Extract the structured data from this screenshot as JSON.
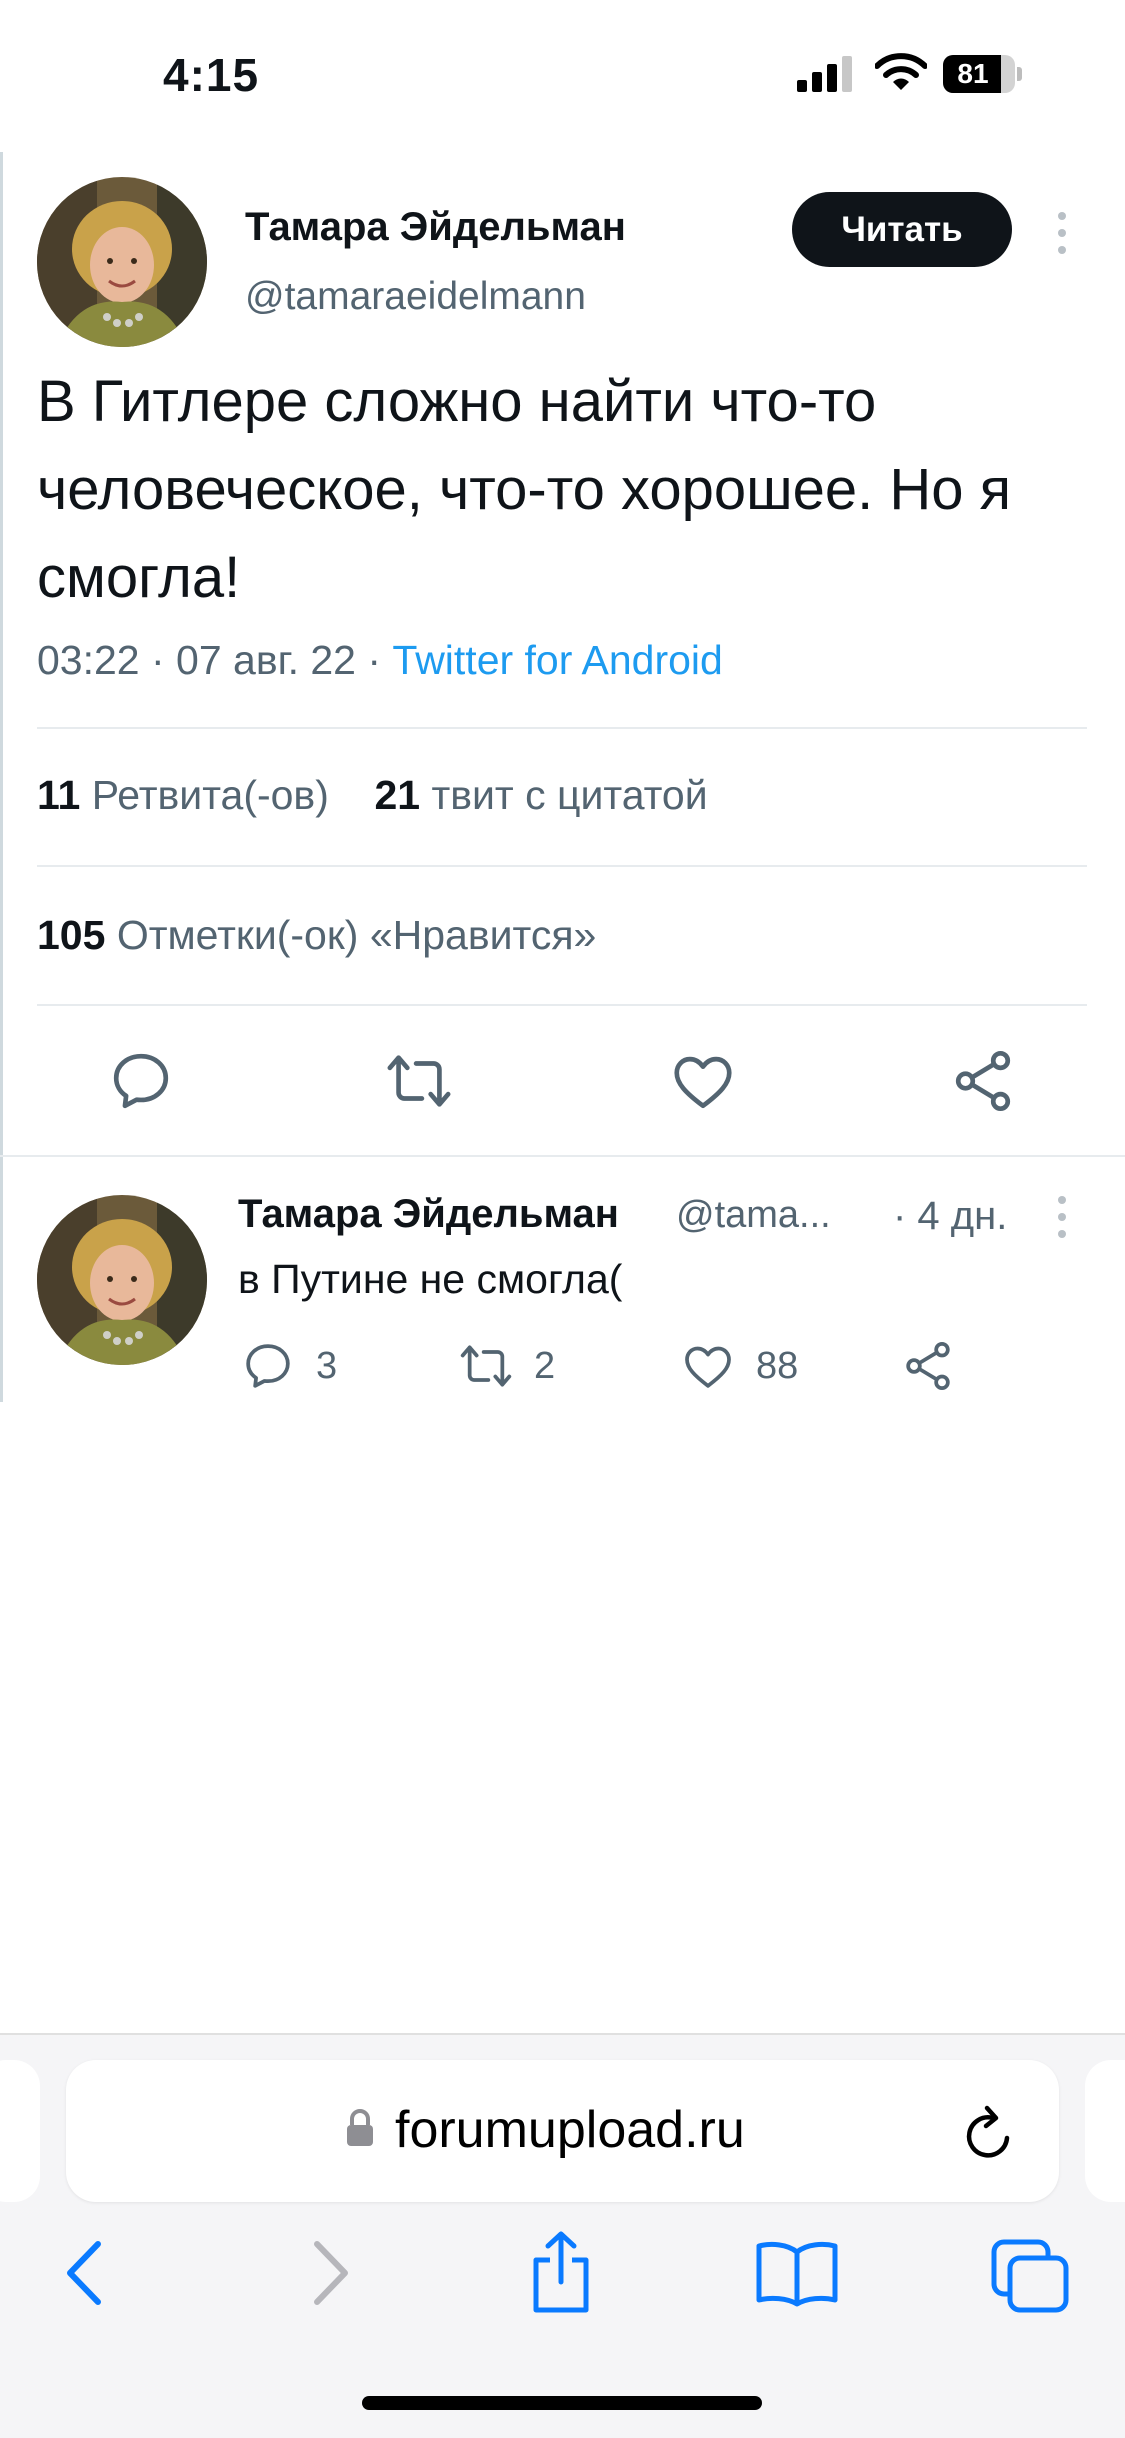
{
  "status_bar": {
    "time": "4:15",
    "battery": "81",
    "battery_level": 0.81
  },
  "tweet": {
    "author_name": "Тамара Эйдельман",
    "author_handle": "@tamaraeidelmann",
    "follow_label": "Читать",
    "text": "В Гитлере сложно найти что-то человеческое, что-то хорошее. Но я смогла!",
    "time": "03:22",
    "separator": " · ",
    "date": "07 авг. 22",
    "source": "Twitter for Android",
    "retweets_count": "11",
    "retweets_label": "Ретвита(-ов)",
    "quotes_count": "21",
    "quotes_label": "твит с цитатой",
    "likes_count": "105",
    "likes_label": "Отметки(-ок) «Нравится»"
  },
  "reply": {
    "author_name": "Тамара Эйдельман",
    "author_handle": "@tama...",
    "time": "· 4 дн.",
    "text": "в Путине не смогла(",
    "reply_count": "3",
    "retweet_count": "2",
    "like_count": "88"
  },
  "browser": {
    "url": "forumupload.ru"
  },
  "colors": {
    "accent": "#1d9bf0",
    "safari_blue": "#0a7aff",
    "text": "#0f1419",
    "secondary": "#536471"
  }
}
